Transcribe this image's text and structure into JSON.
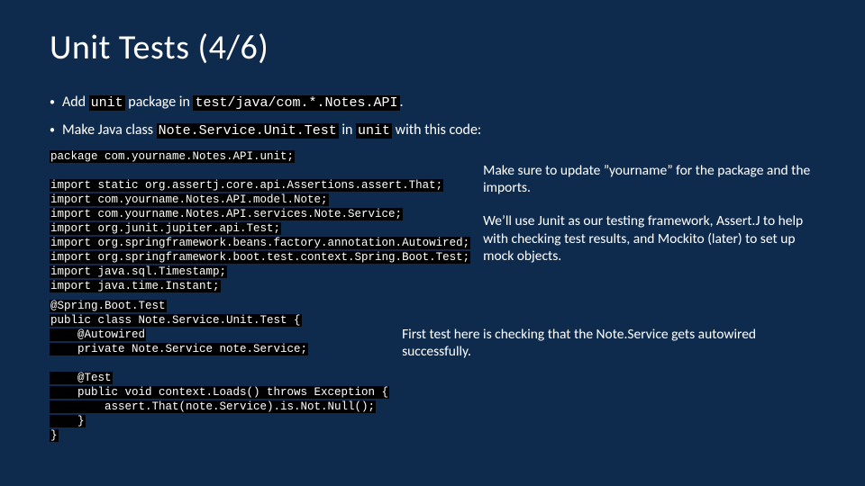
{
  "title": "Unit Tests (4/6)",
  "bullets": [
    {
      "pre": "Add ",
      "c1": "unit",
      "mid": " package in ",
      "c2": "test/java/com.*.Notes.API",
      "post": "."
    },
    {
      "pre": "Make Java class ",
      "c1": "Note.Service.Unit.Test",
      "mid": " in ",
      "c2": "unit",
      "post": " with this code:"
    }
  ],
  "code": {
    "pkg": "package com.yourname.Notes.API.unit;",
    "imp1": "import static org.assertj.core.api.Assertions.assert.That;",
    "imp2": "import com.yourname.Notes.API.model.Note;",
    "imp3": "import com.yourname.Notes.API.services.Note.Service;",
    "imp4": "import org.junit.jupiter.api.Test;",
    "imp5": "import org.springframework.beans.factory.annotation.Autowired;",
    "imp6": "import org.springframework.boot.test.context.Spring.Boot.Test;",
    "imp7": "import java.sql.Timestamp;",
    "imp8": "import java.time.Instant;",
    "cls1": "@Spring.Boot.Test",
    "cls2": "public class Note.Service.Unit.Test {",
    "cls3": "    @Autowired",
    "cls4": "    private Note.Service note.Service;",
    "tst1": "    @Test",
    "tst2": "    public void context.Loads() throws Exception {",
    "tst3": "        assert.That(note.Service).is.Not.Null();",
    "tst4": "    }",
    "tst5": "}"
  },
  "notes": {
    "n1": "Make sure to update ”yourname” for the package and the imports.",
    "n2": "We’ll use Junit as our testing framework, Assert.J to help with checking test results, and Mockito (later) to set up mock objects.",
    "n3": "First test here is checking that the Note.Service gets autowired successfully."
  }
}
